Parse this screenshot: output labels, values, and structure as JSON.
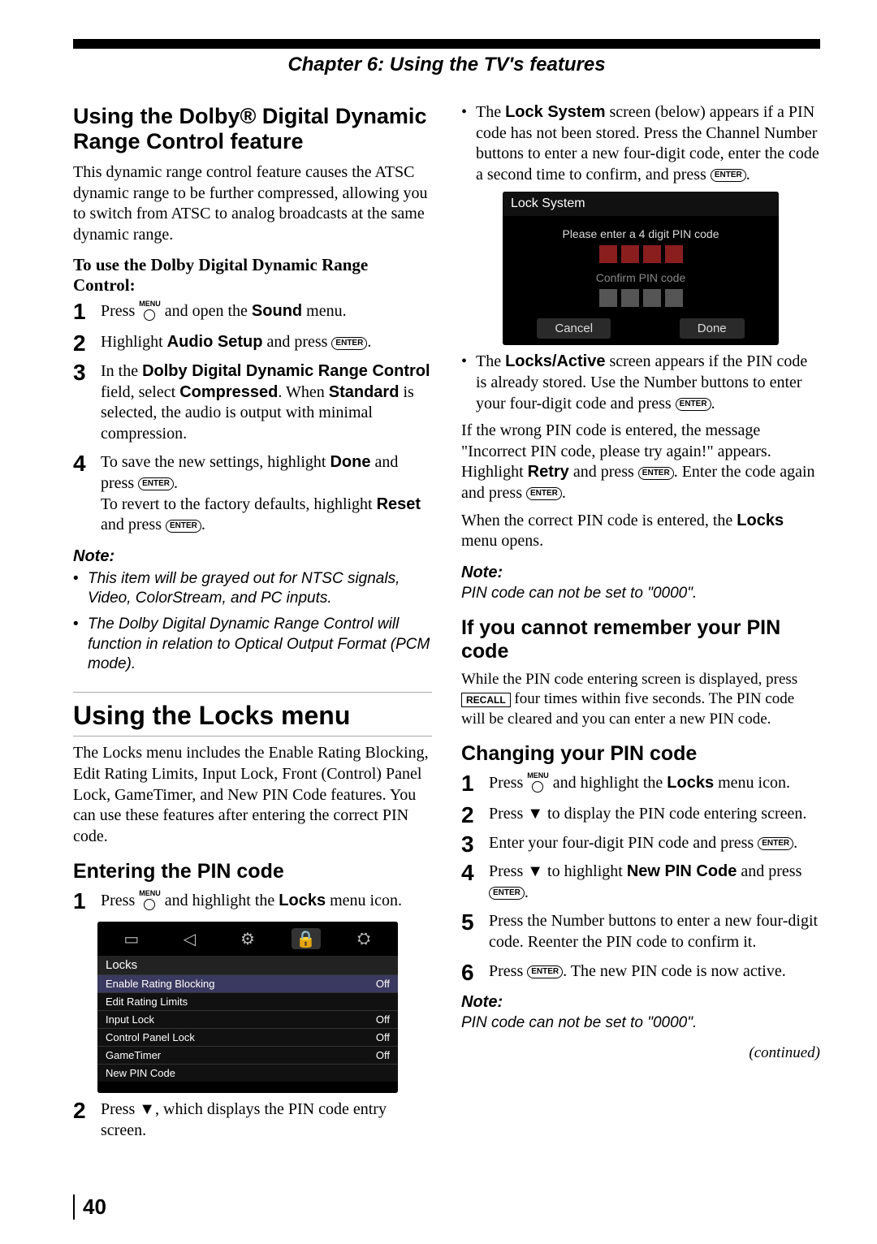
{
  "chapter_header": "Chapter 6: Using the TV's features",
  "page_num": "40",
  "continued": "(continued)",
  "left": {
    "h_dolby": "Using the Dolby® Digital Dynamic Range Control feature",
    "p_dolby_intro": "This dynamic range control feature causes the ATSC dynamic range to be further compressed, allowing you to switch from ATSC to analog broadcasts at the same dynamic range.",
    "p_dolby_touse": "To use the Dolby Digital Dynamic Range Control:",
    "step1_a": "Press ",
    "step1_b": " and open the ",
    "step1_sound": "Sound",
    "step1_c": " menu.",
    "step2_a": "Highlight ",
    "step2_audio": "Audio Setup",
    "step2_b": " and press ",
    "step3_a": "In the ",
    "step3_field": "Dolby Digital Dynamic Range Control",
    "step3_b": " field, select ",
    "step3_comp": "Compressed",
    "step3_c": ". When ",
    "step3_std": "Standard",
    "step3_d": " is selected, the audio is output with minimal compression.",
    "step4_a": "To save the new settings, highlight ",
    "step4_done": "Done",
    "step4_b": " and press ",
    "step4_c": "To revert to the factory defaults, highlight ",
    "step4_reset": "Reset",
    "step4_d": " and press ",
    "note_label": "Note:",
    "note_b1": "This item will be grayed out for NTSC signals, Video, ColorStream, and PC inputs.",
    "note_b2": "The Dolby Digital Dynamic Range Control will function in relation to Optical Output Format (PCM mode).",
    "h_locks": "Using the Locks menu",
    "p_locks_intro": "The Locks menu includes the Enable Rating Blocking, Edit Rating Limits, Input Lock, Front (Control) Panel Lock, GameTimer, and New PIN Code features. You can use these features after entering the correct PIN code.",
    "h_entering": "Entering the PIN code",
    "ent_step1_a": "Press ",
    "ent_step1_b": " and highlight the ",
    "ent_step1_locks": "Locks",
    "ent_step1_c": " menu icon.",
    "ent_step2": "Press ▼, which displays the PIN code entry screen.",
    "ui_locks": {
      "title": "Locks",
      "rows": [
        {
          "label": "Enable Rating Blocking",
          "val": "Off"
        },
        {
          "label": "Edit Rating Limits",
          "val": ""
        },
        {
          "label": "Input Lock",
          "val": "Off"
        },
        {
          "label": "Control Panel Lock",
          "val": "Off"
        },
        {
          "label": "GameTimer",
          "val": "Off"
        },
        {
          "label": "New PIN Code",
          "val": ""
        }
      ]
    }
  },
  "right": {
    "bul1_a": "The ",
    "bul1_ls": "Lock System",
    "bul1_b": " screen (below) appears if a PIN code has not been stored. Press the Channel Number buttons to enter a new four-digit code, enter the code a second time to confirm, and press ",
    "ui_pin": {
      "title": "Lock System",
      "msg": "Please enter a 4 digit PIN code",
      "confirm": "Confirm PIN code",
      "cancel": "Cancel",
      "done": "Done"
    },
    "bul2_a": "The ",
    "bul2_la": "Locks/Active",
    "bul2_b": " screen appears if the PIN code is already stored. Use the Number buttons to enter your four-digit code and press ",
    "p_wrong_a": "If the wrong PIN code is entered, the message \"Incorrect PIN code, please try again!\" appears. Highlight ",
    "p_wrong_retry": "Retry",
    "p_wrong_b": " and press ",
    "p_wrong_c": ". Enter the code again and press ",
    "p_correct_a": "When the correct PIN code is entered, the ",
    "p_correct_locks": "Locks",
    "p_correct_b": " menu opens.",
    "note_label": "Note:",
    "note_pin": "PIN code can not be set to \"0000\".",
    "h_forgot": "If you cannot remember your PIN code",
    "p_forgot_a": "While the PIN code entering screen is displayed, press ",
    "p_forgot_b": " four times within five seconds. The PIN code will be cleared and you can enter a new PIN code.",
    "h_change": "Changing your PIN code",
    "ch1_a": "Press ",
    "ch1_b": " and highlight the ",
    "ch1_locks": "Locks",
    "ch1_c": " menu icon.",
    "ch2": "Press ▼ to display the PIN code entering screen.",
    "ch3_a": "Enter your four-digit PIN code and press ",
    "ch4_a": "Press ▼ to highlight ",
    "ch4_new": "New PIN Code",
    "ch4_b": " and press ",
    "ch5": "Press the Number buttons to enter a new four-digit code. Reenter the PIN code to confirm it.",
    "ch6_a": "Press ",
    "ch6_b": ". The new PIN code is now active.",
    "note2_label": "Note:",
    "note2_pin": "PIN code can not be set to \"0000\"."
  },
  "keys": {
    "menu": "MENU",
    "enter": "ENTER",
    "recall": "RECALL"
  }
}
